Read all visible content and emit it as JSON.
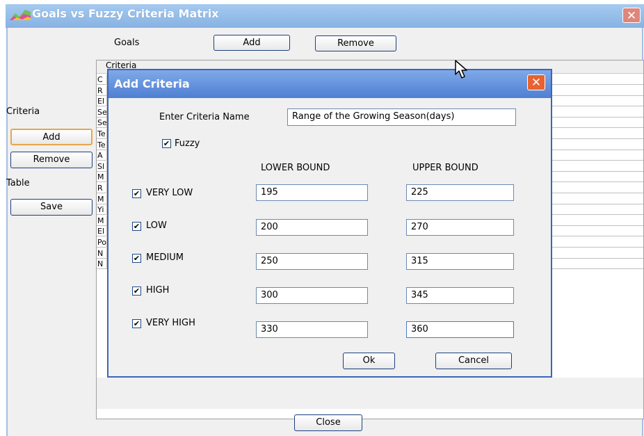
{
  "window": {
    "title": "Goals vs Fuzzy Criteria Matrix",
    "close_glyph": "✕",
    "titlebar_color": "#9fc3ec"
  },
  "goals": {
    "label": "Goals",
    "add_label": "Add",
    "remove_label": "Remove"
  },
  "sidebar": {
    "criteria_label": "Criteria",
    "add_label": "Add",
    "remove_label": "Remove",
    "table_label": "Table",
    "save_label": "Save"
  },
  "table": {
    "header": "Criteria",
    "row_initials": [
      "C",
      "R",
      "El",
      "Se",
      "Se",
      "Te",
      "Te",
      "A",
      "Sl",
      "M",
      "R",
      "M",
      "Yi",
      "M",
      "El",
      "Po",
      "N",
      "N"
    ]
  },
  "footer": {
    "close_label": "Close"
  },
  "dialog": {
    "title": "Add Criteria",
    "close_glyph": "✕",
    "name_label": "Enter Criteria Name",
    "name_value": "Range of the Growing Season(days)",
    "fuzzy_label": "Fuzzy",
    "fuzzy_checked": true,
    "lower_header": "LOWER BOUND",
    "upper_header": "UPPER BOUND",
    "rows": [
      {
        "label": "VERY LOW",
        "checked": true,
        "lower": "195",
        "upper": "225"
      },
      {
        "label": "LOW",
        "checked": true,
        "lower": "200",
        "upper": "270"
      },
      {
        "label": "MEDIUM",
        "checked": true,
        "lower": "250",
        "upper": "315"
      },
      {
        "label": "HIGH",
        "checked": true,
        "lower": "300",
        "upper": "345"
      },
      {
        "label": "VERY HIGH",
        "checked": true,
        "lower": "330",
        "upper": "360"
      }
    ],
    "ok_label": "Ok",
    "cancel_label": "Cancel",
    "check_glyph": "✔",
    "titlebar_color": "#4f7fd2"
  }
}
